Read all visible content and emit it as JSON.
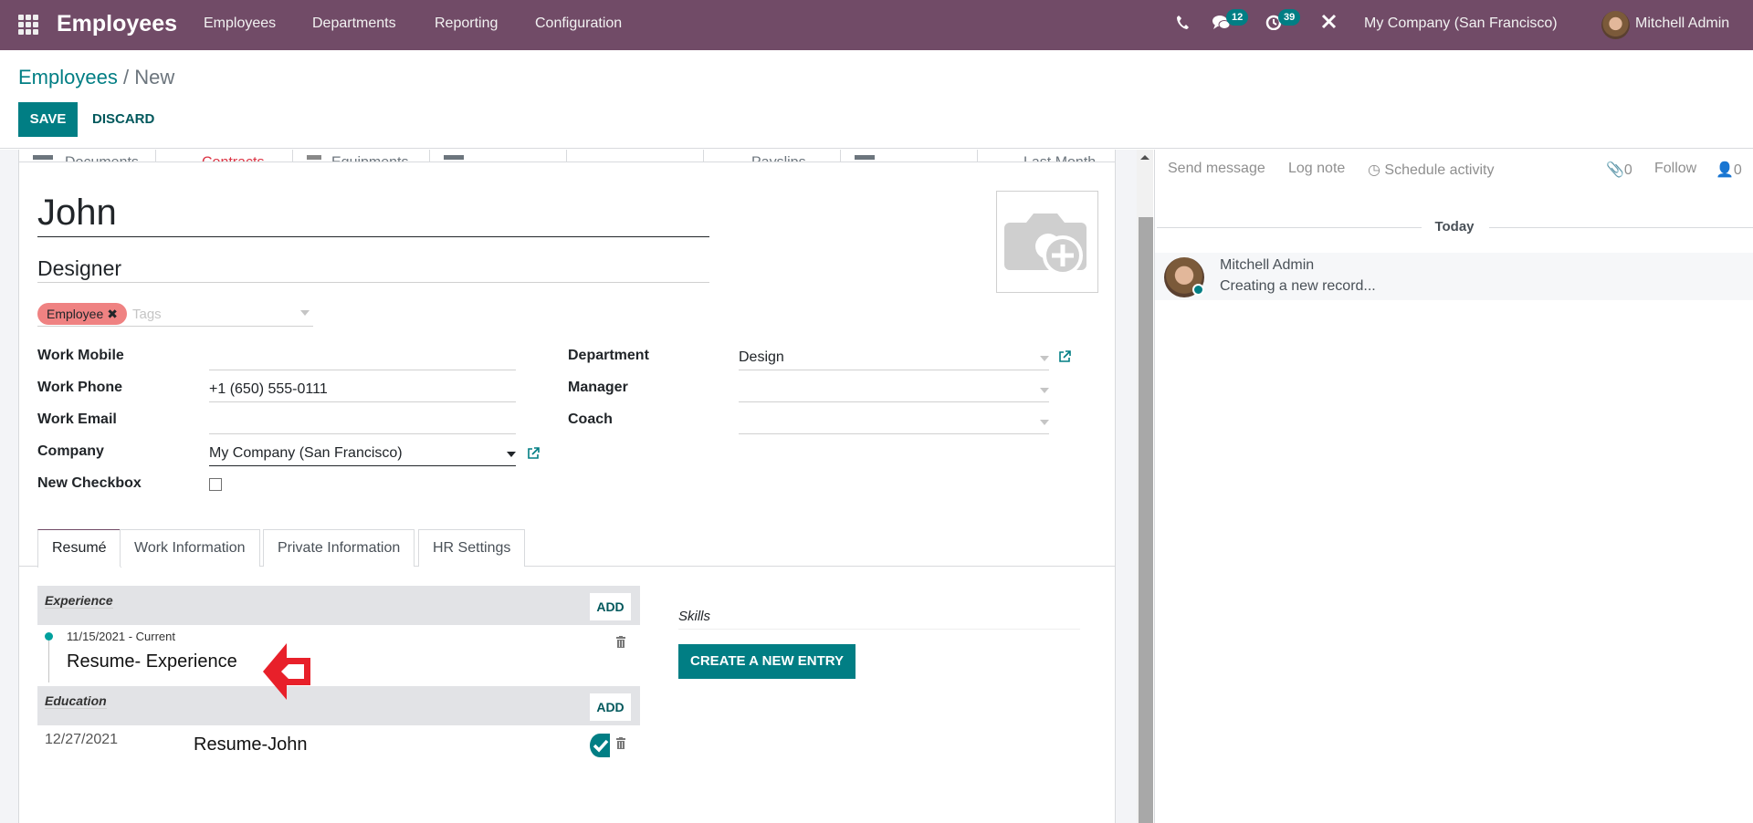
{
  "navbar": {
    "app_title": "Employees",
    "menu": [
      "Employees",
      "Departments",
      "Reporting",
      "Configuration"
    ],
    "messages_badge": "12",
    "activities_badge": "39",
    "company": "My Company (San Francisco)",
    "user": "Mitchell Admin",
    "colors": {
      "brand": "#714B67",
      "accent": "#017e84"
    }
  },
  "control_panel": {
    "breadcrumb": {
      "parent": "Employees",
      "separator": "/",
      "current": "New"
    },
    "save_label": "SAVE",
    "discard_label": "DISCARD"
  },
  "smart_buttons": [
    {
      "label": "Documents",
      "icon": "folder-icon"
    },
    {
      "label": "Contracts",
      "icon": "",
      "highlight": "red"
    },
    {
      "label": "Equipments",
      "icon": "equipment-icon"
    },
    {
      "label": "",
      "icon": "card-icon"
    },
    {
      "label": "",
      "icon": ""
    },
    {
      "label": "Payslips",
      "icon": ""
    },
    {
      "label": "",
      "icon": "card-icon"
    },
    {
      "label": "Last Month",
      "icon": ""
    }
  ],
  "employee": {
    "name": "John",
    "job_title": "Designer",
    "tags": [
      {
        "label": "Employee",
        "color": "#ef8282"
      }
    ],
    "tags_placeholder": "Tags"
  },
  "fields_left": [
    {
      "label": "Work Mobile",
      "value": ""
    },
    {
      "label": "Work Phone",
      "value": "+1 (650) 555-0111"
    },
    {
      "label": "Work Email",
      "value": ""
    },
    {
      "label": "Company",
      "value": "My Company (San Francisco)"
    },
    {
      "label": "New Checkbox",
      "value": false
    }
  ],
  "fields_right": [
    {
      "label": "Department",
      "value": "Design"
    },
    {
      "label": "Manager",
      "value": ""
    },
    {
      "label": "Coach",
      "value": ""
    }
  ],
  "tabs": [
    {
      "label": "Resumé",
      "active": true
    },
    {
      "label": "Work Information",
      "active": false
    },
    {
      "label": "Private Information",
      "active": false
    },
    {
      "label": "HR Settings",
      "active": false
    }
  ],
  "resume": {
    "sections": [
      {
        "title": "Experience",
        "add_label": "ADD",
        "lines": [
          {
            "date": "11/15/2021 - Current",
            "name": "Resume- Experience"
          }
        ]
      },
      {
        "title": "Education",
        "add_label": "ADD",
        "lines": [
          {
            "date": "12/27/2021",
            "name": "Resume-John"
          }
        ]
      }
    ],
    "skills_title": "Skills",
    "create_entry_label": "CREATE A NEW ENTRY"
  },
  "chatter": {
    "send_message": "Send message",
    "log_note": "Log note",
    "schedule_activity": "Schedule activity",
    "attachments_count": "0",
    "follow": "Follow",
    "followers_count": "0",
    "date_separator": "Today",
    "messages": [
      {
        "author": "Mitchell Admin",
        "body": "Creating a new record..."
      }
    ]
  }
}
